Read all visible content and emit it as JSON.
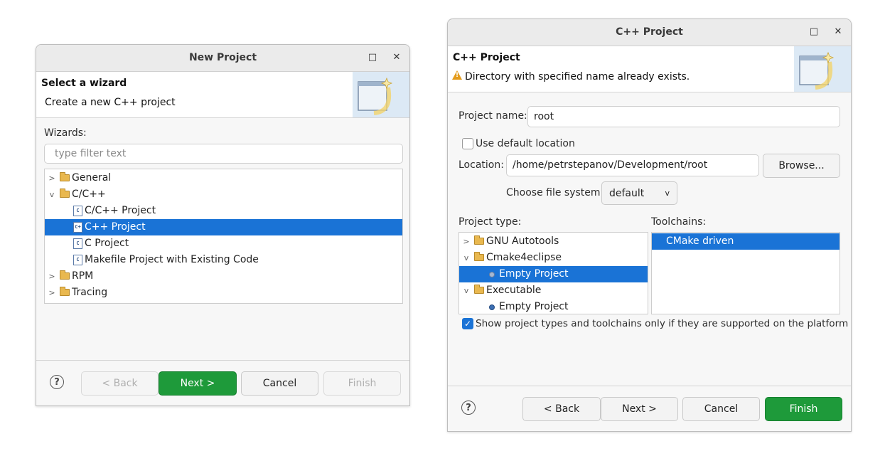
{
  "left_dialog": {
    "title": "New Project",
    "banner_title": "Select a wizard",
    "banner_subtitle": "Create a new C++ project",
    "wizards_label": "Wizards:",
    "filter_placeholder": "type filter text",
    "tree": [
      {
        "label": "General"
      },
      {
        "label": "C/C++"
      },
      {
        "label": "C/C++ Project"
      },
      {
        "label": "C++ Project",
        "selected": true
      },
      {
        "label": "C Project"
      },
      {
        "label": "Makefile Project with Existing Code"
      },
      {
        "label": "RPM"
      },
      {
        "label": "Tracing"
      }
    ],
    "buttons": {
      "back": "< Back",
      "next": "Next >",
      "cancel": "Cancel",
      "finish": "Finish"
    }
  },
  "right_dialog": {
    "title": "C++ Project",
    "banner_title": "C++ Project",
    "warning": "Directory with specified name already exists.",
    "project_name_label": "Project name:",
    "project_name_value": "root",
    "use_default_location": "Use default location",
    "location_label": "Location:",
    "location_value": "/home/petrstepanov/Development/root",
    "browse": "Browse...",
    "file_system_label": "Choose file system:",
    "file_system_value": "default",
    "project_type_label": "Project type:",
    "toolchains_label": "Toolchains:",
    "project_types": [
      {
        "label": "GNU Autotools"
      },
      {
        "label": "Cmake4eclipse"
      },
      {
        "label": "Empty Project",
        "selected": true
      },
      {
        "label": "Executable"
      },
      {
        "label": "Empty Project"
      }
    ],
    "toolchains": [
      {
        "label": "CMake driven",
        "selected": true
      }
    ],
    "show_supported": "Show project types and toolchains only if they are supported on the platform",
    "buttons": {
      "back": "< Back",
      "next": "Next >",
      "cancel": "Cancel",
      "finish": "Finish"
    }
  },
  "colors": {
    "selection": "#1a73d6",
    "primary_button": "#1e9a3a",
    "warning": "#e39b1b"
  }
}
